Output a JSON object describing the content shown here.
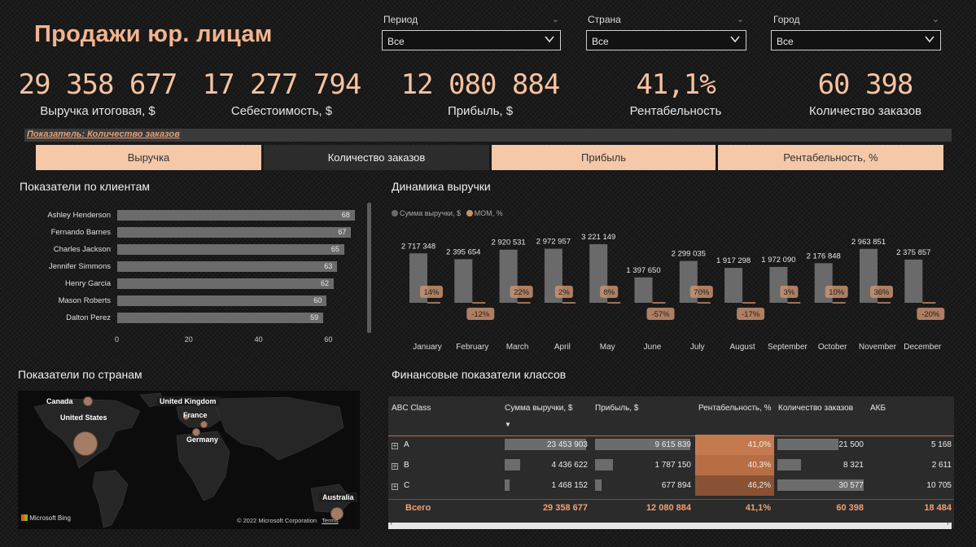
{
  "title": "Продажи юр. лицам",
  "filters": [
    {
      "label": "Период",
      "value": "Все"
    },
    {
      "label": "Страна",
      "value": "Все"
    },
    {
      "label": "Город",
      "value": "Все"
    }
  ],
  "kpis": [
    {
      "value": "29 358 677",
      "label": "Выручка итоговая, $"
    },
    {
      "value": "17 277 794",
      "label": "Себестоимость, $"
    },
    {
      "value": "12 080 884",
      "label": "Прибыль, $"
    },
    {
      "value": "41,1%",
      "label": "Рентабельность"
    },
    {
      "value": "60 398",
      "label": "Количество заказов"
    }
  ],
  "indicator_label": "Показатель: Количество заказов",
  "tabs": [
    {
      "label": "Выручка",
      "active": false
    },
    {
      "label": "Количество заказов",
      "active": true
    },
    {
      "label": "Прибыль",
      "active": false
    },
    {
      "label": "Рентабельность, %",
      "active": false
    }
  ],
  "customers": {
    "title": "Показатели по клиентам",
    "chart_data": {
      "type": "bar",
      "orientation": "horizontal",
      "categories": [
        "Ashley Henderson",
        "Fernando Barnes",
        "Charles Jackson",
        "Jennifer Simmons",
        "Henry Garcia",
        "Mason Roberts",
        "Dalton Perez"
      ],
      "values": [
        68,
        67,
        65,
        63,
        62,
        60,
        59
      ],
      "xticks": [
        "0",
        "20",
        "40",
        "60"
      ],
      "xlim": [
        0,
        70
      ]
    }
  },
  "revenue": {
    "title": "Динамика выручки",
    "legend": [
      "Сумма выручки, $",
      "МОМ, %"
    ],
    "colors": {
      "bars": "#6a6a6a",
      "mom": "#c8906e"
    },
    "chart_data": {
      "type": "bar",
      "categories": [
        "January",
        "February",
        "March",
        "April",
        "May",
        "June",
        "July",
        "August",
        "September",
        "October",
        "November",
        "December"
      ],
      "series": [
        {
          "name": "Сумма выручки, $",
          "values": [
            2717348,
            2395654,
            2920531,
            2972957,
            3221149,
            1397650,
            2299035,
            1917298,
            1972090,
            2176848,
            2963851,
            2375857
          ],
          "labels": [
            "2 717 348",
            "2 395 654",
            "2 920 531",
            "2 972 957",
            "3 221 149",
            "1 397 650",
            "2 299 035",
            "1 917 298",
            "1 972 090",
            "2 176 848",
            "2 963 851",
            "2 375 857"
          ]
        },
        {
          "name": "МОМ, %",
          "values": [
            14,
            -12,
            22,
            2,
            8,
            -57,
            70,
            -17,
            3,
            10,
            36,
            -20
          ],
          "labels": [
            "14%",
            "-12%",
            "22%",
            "2%",
            "8%",
            "-57%",
            "70%",
            "-17%",
            "3%",
            "10%",
            "36%",
            "-20%"
          ]
        }
      ]
    }
  },
  "countries": {
    "title": "Показатели  по странам",
    "markers": [
      {
        "name": "Canada",
        "size": 12
      },
      {
        "name": "United States",
        "size": 30
      },
      {
        "name": "United Kingdom",
        "size": 7
      },
      {
        "name": "France",
        "size": 9
      },
      {
        "name": "Germany",
        "size": 10
      },
      {
        "name": "Australia",
        "size": 16
      }
    ],
    "brand": "Microsoft Bing",
    "copyright": "© 2022 Microsoft Corporation",
    "terms": "Terms"
  },
  "finance": {
    "title": "Финансовые показатели классов",
    "columns": [
      "ABC Class",
      "Сумма выручки, $",
      "Прибыль, $",
      "Рентабельность, %",
      "Количество заказов",
      "АКБ"
    ],
    "rows": [
      {
        "cls": "A",
        "revenue": "23 453 903",
        "revenue_v": 23453903,
        "profit": "9 615 839",
        "profit_v": 9615839,
        "margin": "41,0%",
        "orders": "21 500",
        "orders_v": 21500,
        "akb": "5 168"
      },
      {
        "cls": "B",
        "revenue": "4 436 622",
        "revenue_v": 4436622,
        "profit": "1 787 150",
        "profit_v": 1787150,
        "margin": "40,3%",
        "orders": "8 321",
        "orders_v": 8321,
        "akb": "2 611"
      },
      {
        "cls": "C",
        "revenue": "1 468 152",
        "revenue_v": 1468152,
        "profit": "677 894",
        "profit_v": 677894,
        "margin": "46,2%",
        "orders": "30 577",
        "orders_v": 30577,
        "akb": "10 705"
      }
    ],
    "total": {
      "label": "Всего",
      "revenue": "29 358 677",
      "profit": "12 080 884",
      "margin": "41,1%",
      "orders": "60 398",
      "akb": "18 484"
    },
    "margin_colors": [
      "#c47a4e",
      "#b86e44",
      "#8a5234"
    ]
  }
}
